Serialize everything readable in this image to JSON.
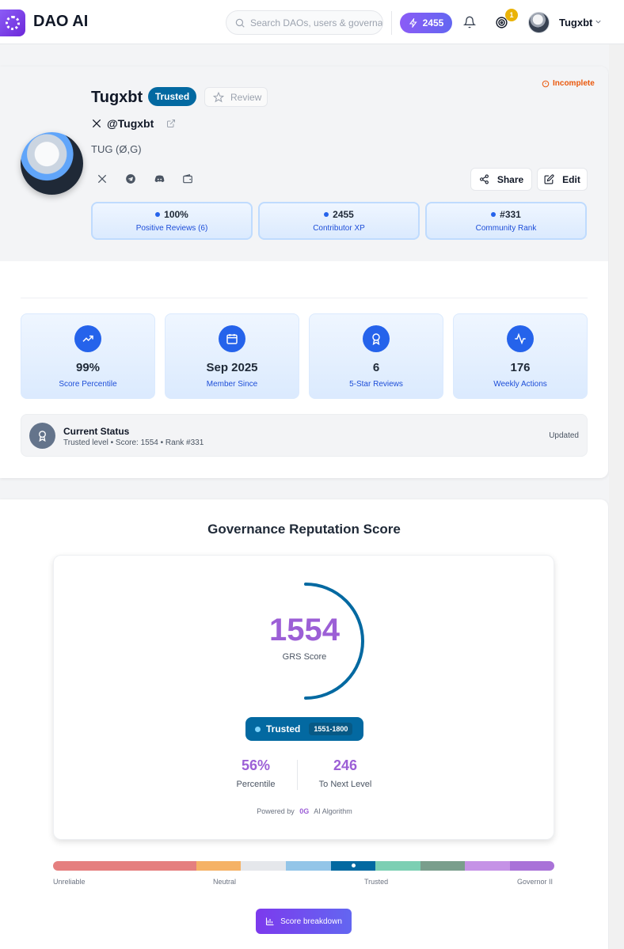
{
  "header": {
    "brand": "DAO AI",
    "search_placeholder": "Search DAOs, users & governance",
    "xp": "2455",
    "notification_count": "1",
    "username": "Tugxbt"
  },
  "profile": {
    "status_flag": "Incomplete",
    "name": "Tugxbt",
    "badge": "Trusted",
    "review_label": "Review",
    "handle": "@Tugxbt",
    "ticker": "TUG (Ø,G)",
    "share_label": "Share",
    "edit_label": "Edit",
    "mini_stats": [
      {
        "value": "100%",
        "label": "Positive Reviews (6)"
      },
      {
        "value": "2455",
        "label": "Contributor XP"
      },
      {
        "value": "#331",
        "label": "Community Rank"
      }
    ],
    "stats": [
      {
        "value": "99%",
        "label": "Score Percentile",
        "icon": "trending-up-icon"
      },
      {
        "value": "Sep 2025",
        "label": "Member Since",
        "icon": "calendar-icon"
      },
      {
        "value": "6",
        "label": "5-Star Reviews",
        "icon": "award-icon"
      },
      {
        "value": "176",
        "label": "Weekly Actions",
        "icon": "activity-icon"
      }
    ],
    "current_status": {
      "title": "Current Status",
      "detail": "Trusted level • Score: 1554 • Rank #331",
      "updated": "Updated"
    }
  },
  "score": {
    "title": "Governance Reputation Score",
    "value": "1554",
    "label": "GRS Score",
    "gauge_fraction": 0.5,
    "tier": "Trusted",
    "tier_range": "1551-1800",
    "percentile": "56%",
    "percentile_label": "Percentile",
    "to_next": "246",
    "to_next_label": "To Next Level",
    "powered_prefix": "Powered by",
    "powered_brand": "0G",
    "powered_suffix": "AI Algorithm",
    "tier_labels": [
      "Unreliable",
      "Neutral",
      "Trusted",
      "Governor II"
    ],
    "breakdown_label": "Score breakdown"
  },
  "colors": {
    "accent": "#9c5fd6",
    "trusted": "#0369a1",
    "incomplete": "#ea580c",
    "tier_segments": [
      "#e57f7f",
      "#f5b266",
      "#e5e7eb",
      "#93c5e8",
      "#0369a1",
      "#7ccfb3",
      "#7a9e8c",
      "#c592e6",
      "#a972d8"
    ]
  }
}
